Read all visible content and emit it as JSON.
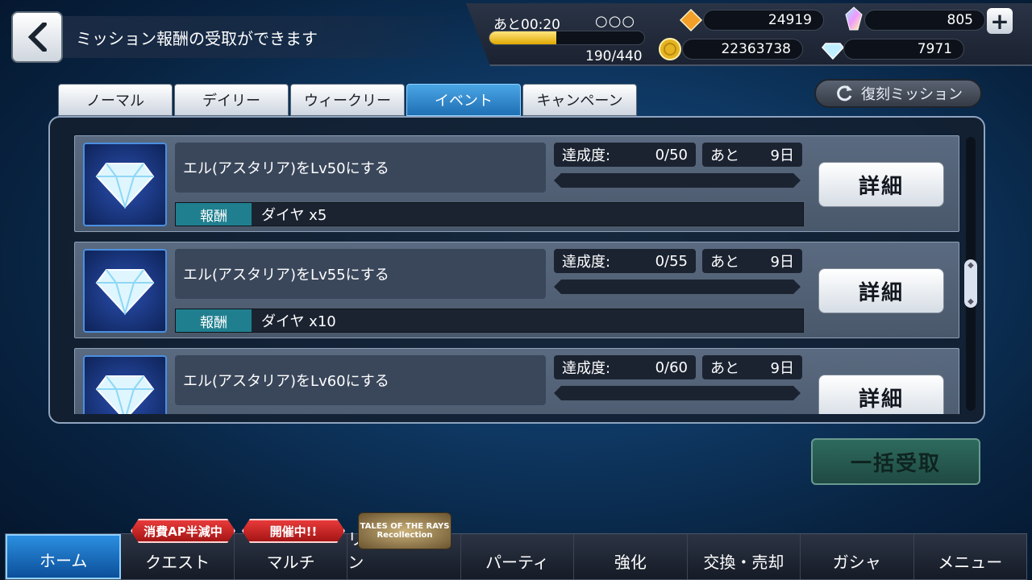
{
  "header": {
    "title": "ミッション報酬の受取ができます"
  },
  "status": {
    "ap_timer": "あと00:20",
    "ap_dots": "○○○",
    "ap_fraction": 0.43,
    "ap_count": "190/440",
    "gald": "22363738",
    "crystal": "24919",
    "gem": "805",
    "diamond": "7971"
  },
  "tabs": [
    {
      "label": "ノーマル"
    },
    {
      "label": "デイリー"
    },
    {
      "label": "ウィークリー"
    },
    {
      "label": "イベント",
      "active": true
    },
    {
      "label": "キャンペーン"
    }
  ],
  "fukkoku_label": "復刻ミッション",
  "missions": [
    {
      "name": "エル(アスタリア)をLv50にする",
      "progress_label": "達成度:",
      "progress": "0/50",
      "remain_label": "あと",
      "remain": "9日",
      "reward_label": "報酬",
      "reward": "ダイヤ x5",
      "detail": "詳細"
    },
    {
      "name": "エル(アスタリア)をLv55にする",
      "progress_label": "達成度:",
      "progress": "0/55",
      "remain_label": "あと",
      "remain": "9日",
      "reward_label": "報酬",
      "reward": "ダイヤ x10",
      "detail": "詳細"
    },
    {
      "name": "エル(アスタリア)をLv60にする",
      "progress_label": "達成度:",
      "progress": "0/60",
      "remain_label": "あと",
      "remain": "9日",
      "reward_label": "報酬",
      "reward": "",
      "detail": "詳細"
    }
  ],
  "bulk_label": "一括受取",
  "badges": {
    "quest": "消費AP半減中",
    "multi": "開催中!!"
  },
  "nav": [
    {
      "label": "ホーム",
      "active": true
    },
    {
      "label": "クエスト"
    },
    {
      "label": "マルチ"
    },
    {
      "label": "リコレクション"
    },
    {
      "label": "パーティ"
    },
    {
      "label": "強化"
    },
    {
      "label": "交換・売却"
    },
    {
      "label": "ガシャ"
    },
    {
      "label": "メニュー"
    }
  ],
  "logo": {
    "line1": "TALES OF THE RAYS",
    "line2": "Recollection"
  },
  "colors": {
    "accent": "#2b8fe0",
    "badge": "#d42a2a",
    "reward_label_bg": "#1f7f8f"
  }
}
